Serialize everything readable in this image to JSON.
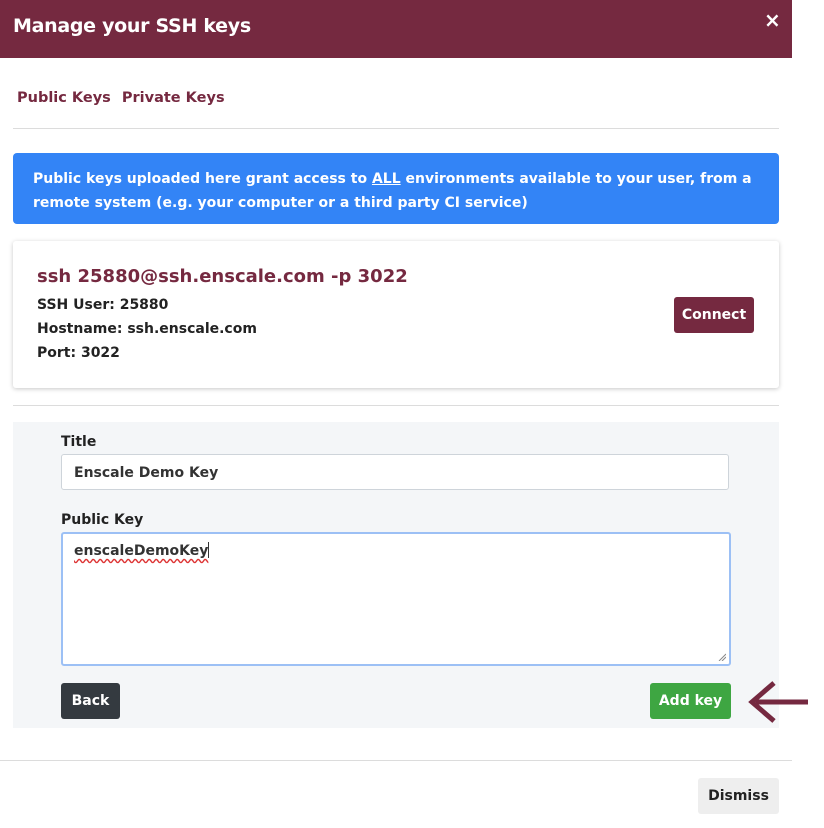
{
  "modal": {
    "title": "Manage your SSH keys",
    "close_glyph": "×"
  },
  "tabs": [
    "Public Keys",
    "Private Keys"
  ],
  "alert": {
    "text_before": "Public keys uploaded here grant access to ",
    "emphasis": "ALL",
    "text_after": " environments available to your user, from a remote system (e.g. your computer or a third party CI service)"
  },
  "ssh_card": {
    "command": "ssh 25880@ssh.enscale.com -p 3022",
    "user_line": "SSH User: 25880",
    "host_line": "Hostname: ssh.enscale.com",
    "port_line": "Port: 3022",
    "connect_label": "Connect"
  },
  "form": {
    "title_label": "Title",
    "title_value": "Enscale Demo Key",
    "public_key_label": "Public Key",
    "public_key_value": "enscaleDemoKey",
    "back_label": "Back",
    "add_key_label": "Add key"
  },
  "footer": {
    "dismiss_label": "Dismiss"
  },
  "colors": {
    "brand": "#752940",
    "alert_blue": "#3384f6",
    "success_green": "#3ea642",
    "dark_button": "#343a40"
  },
  "icons": {
    "close": "close-icon",
    "annotation_arrow": "arrow-left-icon"
  }
}
